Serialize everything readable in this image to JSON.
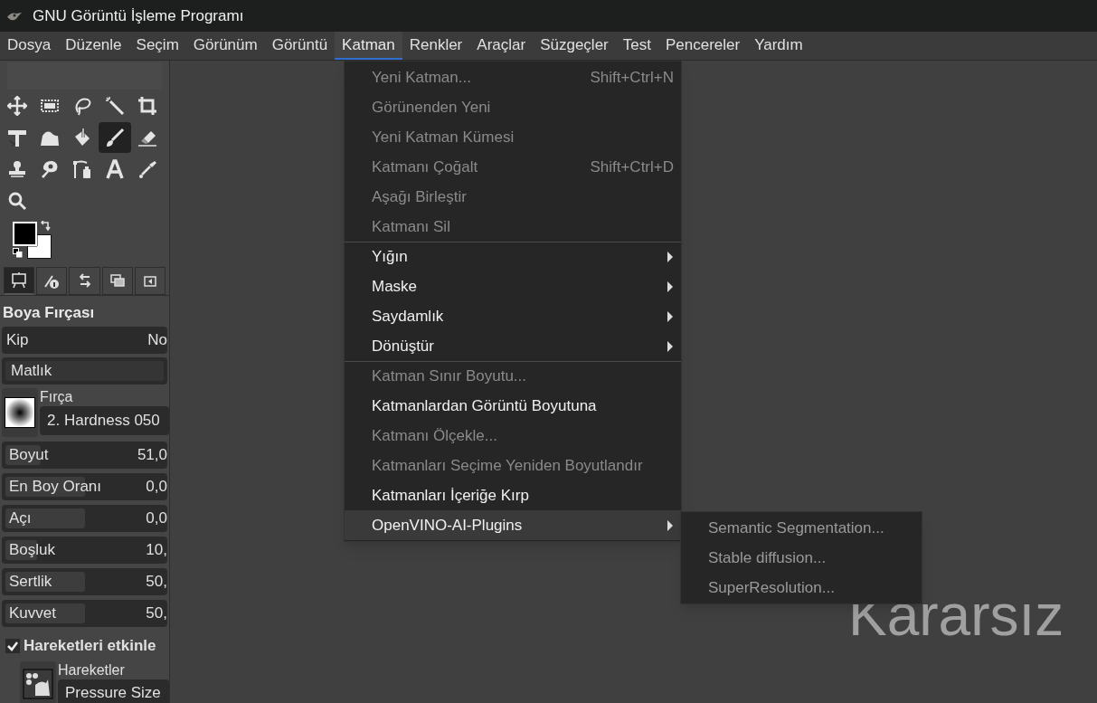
{
  "window": {
    "title": "GNU Görüntü İşleme Programı"
  },
  "menubar": [
    {
      "label": "Dosya",
      "selected": false
    },
    {
      "label": "Düzenle",
      "selected": false
    },
    {
      "label": "Seçim",
      "selected": false
    },
    {
      "label": "Görünüm",
      "selected": false
    },
    {
      "label": "Görüntü",
      "selected": false
    },
    {
      "label": "Katman",
      "selected": true
    },
    {
      "label": "Renkler",
      "selected": false
    },
    {
      "label": "Araçlar",
      "selected": false
    },
    {
      "label": "Süzgeçler",
      "selected": false
    },
    {
      "label": "Test",
      "selected": false
    },
    {
      "label": "Pencereler",
      "selected": false
    },
    {
      "label": "Yardım",
      "selected": false
    }
  ],
  "toolbox": [
    {
      "kind": "move",
      "selected": false
    },
    {
      "kind": "rect-select",
      "selected": false
    },
    {
      "kind": "lasso",
      "selected": false
    },
    {
      "kind": "wand",
      "selected": false
    },
    {
      "kind": "crop",
      "selected": false
    },
    {
      "kind": "transform",
      "selected": false
    },
    {
      "kind": "warp",
      "selected": false
    },
    {
      "kind": "fill",
      "selected": false
    },
    {
      "kind": "brush",
      "selected": true
    },
    {
      "kind": "eraser",
      "selected": false
    },
    {
      "kind": "stamp",
      "selected": false
    },
    {
      "kind": "smudge",
      "selected": false
    },
    {
      "kind": "paths",
      "selected": false
    },
    {
      "kind": "text",
      "selected": false
    },
    {
      "kind": "picker",
      "selected": false
    },
    {
      "kind": "zoom",
      "selected": false
    }
  ],
  "colors": [
    {
      "color": "#000000"
    },
    {
      "color": "#ffffff"
    }
  ],
  "dock_tabs": [
    {
      "kind": "options",
      "selected": true
    },
    {
      "kind": "device",
      "selected": false
    },
    {
      "kind": "undo",
      "selected": false
    },
    {
      "kind": "images",
      "selected": false
    },
    {
      "kind": "menu",
      "selected": false
    }
  ],
  "tool_options": {
    "title": "Boya Fırçası",
    "mode": {
      "label": "Kip",
      "value": "No"
    },
    "opacity": {
      "label": "Matlık",
      "level": 1
    },
    "brush": {
      "label": "Fırça",
      "value": "2. Hardness 050"
    },
    "sliders": [
      {
        "label": "Boyut",
        "value": "51,0",
        "level": 0.22
      },
      {
        "label": "En Boy Oranı",
        "value": "0,0",
        "level": 0.5
      },
      {
        "label": "Açı",
        "value": "0,0",
        "level": 0.5
      },
      {
        "label": "Boşluk",
        "value": "10,",
        "level": 0.2
      },
      {
        "label": "Sertlik",
        "value": "50,",
        "level": 0.5
      },
      {
        "label": "Kuvvet",
        "value": "50,",
        "level": 0.5
      }
    ],
    "dynamics_toggle": {
      "label": "Hareketleri etkinle",
      "checked": true
    },
    "dynamics": {
      "label": "Hareketler",
      "value": "Pressure Size"
    }
  },
  "menu": {
    "items": [
      {
        "label": "Yeni Katman...",
        "shortcut": "Shift+Ctrl+N",
        "disabled": true,
        "submenu": false,
        "selected": false,
        "separator_before": false
      },
      {
        "label": "Görünenden Yeni",
        "disabled": true,
        "submenu": false,
        "selected": false,
        "separator_before": false
      },
      {
        "label": "Yeni Katman Kümesi",
        "disabled": true,
        "submenu": false,
        "selected": false,
        "separator_before": false
      },
      {
        "label": "Katmanı Çoğalt",
        "shortcut": "Shift+Ctrl+D",
        "disabled": true,
        "submenu": false,
        "selected": false,
        "separator_before": false
      },
      {
        "label": "Aşağı Birleştir",
        "disabled": true,
        "submenu": false,
        "selected": false,
        "separator_before": false
      },
      {
        "label": "Katmanı Sil",
        "disabled": true,
        "submenu": false,
        "selected": false,
        "separator_before": false
      },
      {
        "label": "Yığın",
        "disabled": false,
        "submenu": true,
        "selected": false,
        "separator_before": true
      },
      {
        "label": "Maske",
        "disabled": false,
        "submenu": true,
        "selected": false,
        "separator_before": false
      },
      {
        "label": "Saydamlık",
        "disabled": false,
        "submenu": true,
        "selected": false,
        "separator_before": false
      },
      {
        "label": "Dönüştür",
        "disabled": false,
        "submenu": true,
        "selected": false,
        "separator_before": false
      },
      {
        "label": "Katman Sınır Boyutu...",
        "disabled": true,
        "submenu": false,
        "selected": false,
        "separator_before": true
      },
      {
        "label": "Katmanlardan Görüntü Boyutuna",
        "disabled": false,
        "submenu": false,
        "selected": false,
        "separator_before": false
      },
      {
        "label": "Katmanı Ölçekle...",
        "disabled": true,
        "submenu": false,
        "selected": false,
        "separator_before": false
      },
      {
        "label": "Katmanları Seçime Yeniden Boyutlandır",
        "disabled": true,
        "submenu": false,
        "selected": false,
        "separator_before": false
      },
      {
        "label": "Katmanları İçeriğe Kırp",
        "disabled": false,
        "submenu": false,
        "selected": false,
        "separator_before": false
      },
      {
        "label": "OpenVINO-AI-Plugins",
        "disabled": false,
        "submenu": true,
        "selected": true,
        "separator_before": false
      }
    ]
  },
  "submenu": {
    "items": [
      {
        "label": "Semantic Segmentation...",
        "disabled": true
      },
      {
        "label": "Stable diffusion...",
        "disabled": true
      },
      {
        "label": "SuperResolution...",
        "disabled": true
      }
    ]
  },
  "canvas": {
    "text": "Kararsız"
  }
}
